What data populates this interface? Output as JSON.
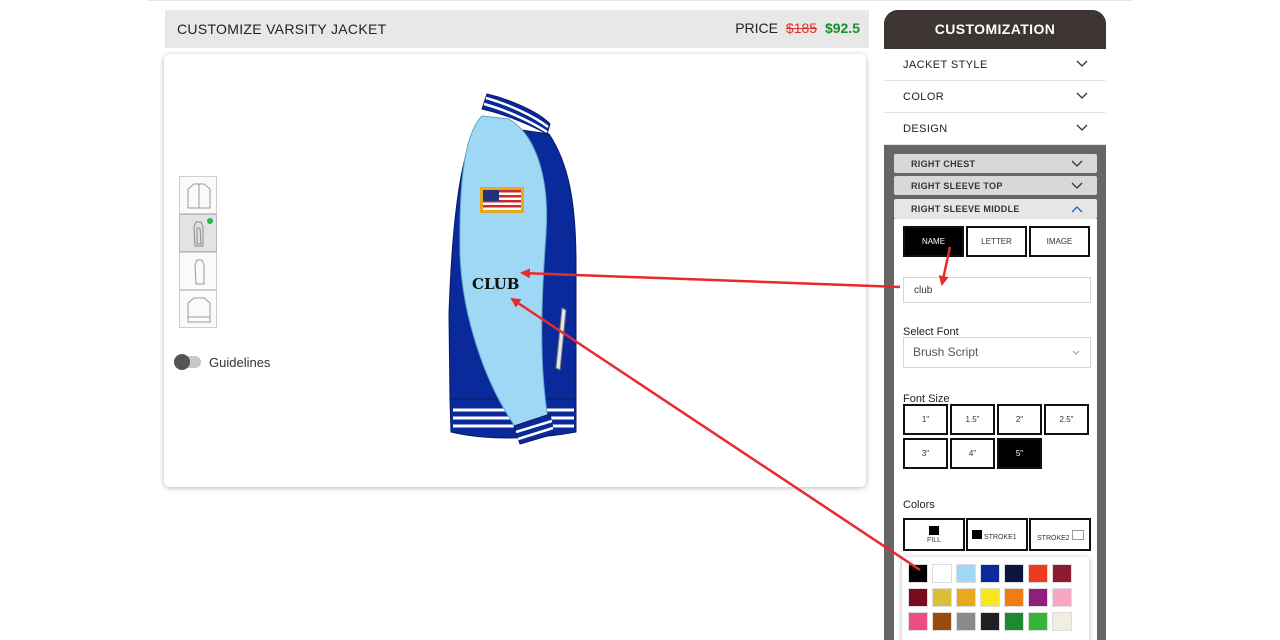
{
  "header": {
    "title": "CUSTOMIZE VARSITY JACKET",
    "price_label": "PRICE",
    "price_old": "$185",
    "price_new": "$92.5"
  },
  "preview": {
    "guidelines_label": "Guidelines",
    "guidelines_on": false,
    "jacket_text": "CLUB",
    "thumbnails": [
      "front-view",
      "side-view",
      "side-view-alt",
      "back-view"
    ],
    "active_thumbnail": 1
  },
  "panel": {
    "title": "CUSTOMIZATION",
    "sections": [
      {
        "label": "JACKET STYLE"
      },
      {
        "label": "COLOR"
      },
      {
        "label": "DESIGN"
      }
    ],
    "design_sections": [
      {
        "label": "RIGHT CHEST"
      },
      {
        "label": "RIGHT SLEEVE TOP"
      },
      {
        "label": "RIGHT SLEEVE MIDDLE"
      }
    ],
    "tabs": [
      {
        "label": "NAME",
        "active": true
      },
      {
        "label": "LETTER",
        "active": false
      },
      {
        "label": "IMAGE",
        "active": false
      }
    ],
    "name_value": "club",
    "select_font_label": "Select Font",
    "font_value": "Brush Script",
    "font_size_label": "Font Size",
    "font_sizes": [
      {
        "label": "1\"",
        "active": false
      },
      {
        "label": "1.5\"",
        "active": false
      },
      {
        "label": "2\"",
        "active": false
      },
      {
        "label": "2.5\"",
        "active": false
      },
      {
        "label": "3\"",
        "active": false
      },
      {
        "label": "4\"",
        "active": false
      },
      {
        "label": "5\"",
        "active": true
      }
    ],
    "colors_label": "Colors",
    "color_buttons": [
      {
        "label": "FILL",
        "swatch": "#000000"
      },
      {
        "label": "STROKE1",
        "swatch": "#000000"
      },
      {
        "label": "STROKE2",
        "swatch": "#ffffff"
      }
    ],
    "palette": [
      "#000000",
      "#ffffff",
      "#9fd8f5",
      "#0a2a9c",
      "#0d1640",
      "#ef3a1c",
      "#8c1d2e",
      "#7c0a1e",
      "#dcbf38",
      "#e8a91e",
      "#f5e81c",
      "#f07d12",
      "#8e1f7a",
      "#f7a6c3",
      "#ee4d84",
      "#9a4a0c",
      "#8a8a8a",
      "#202020",
      "#1c8a32",
      "#38b337",
      "#f2ede1"
    ]
  },
  "colors": {
    "jacket_body": "#0a2a9c",
    "jacket_sleeve": "#9fd8f5",
    "annotation_arrow": "#e82a2a"
  }
}
